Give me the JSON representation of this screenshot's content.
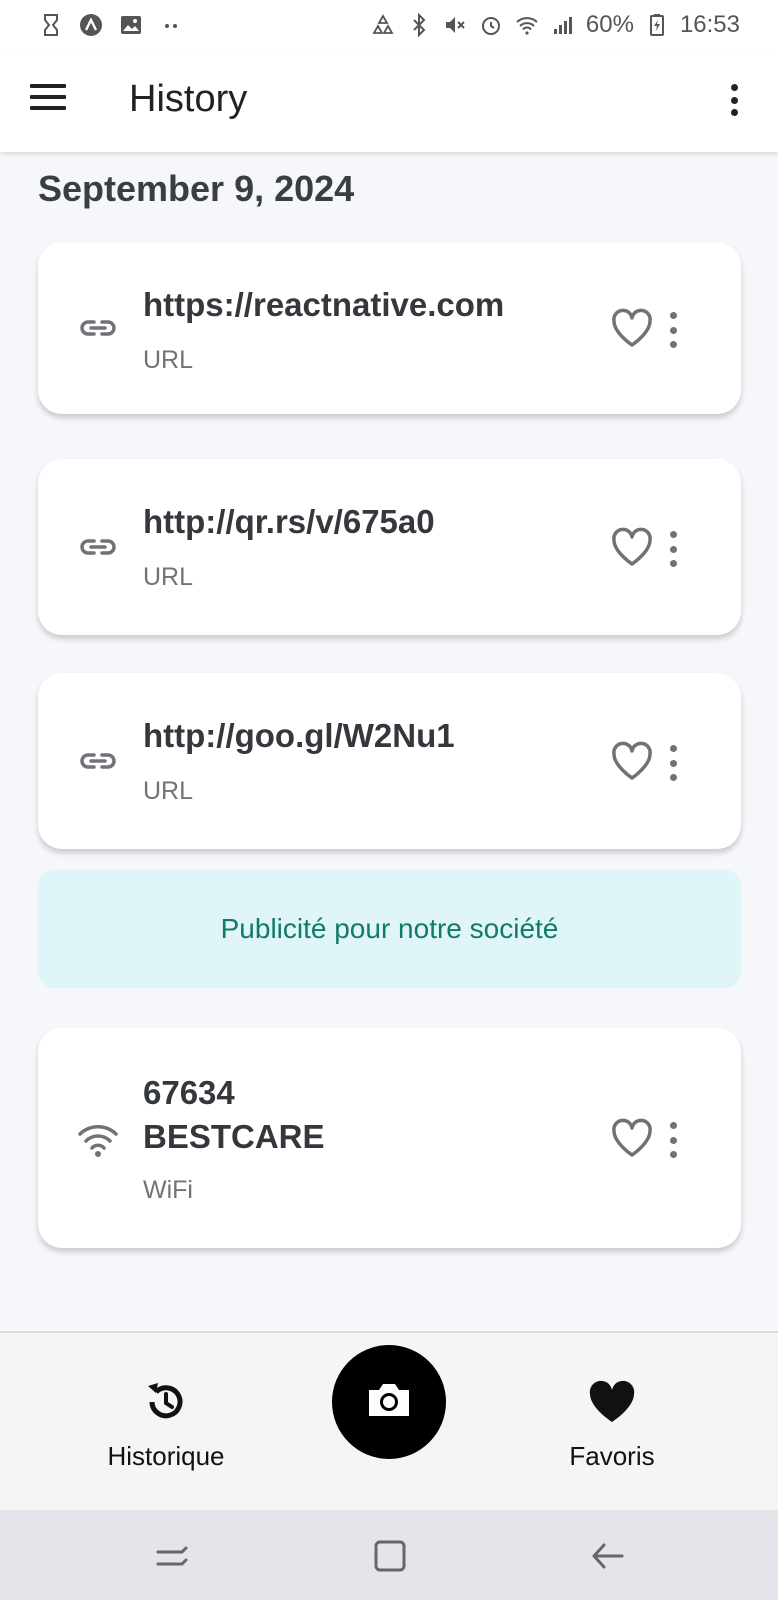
{
  "status_bar": {
    "battery": "60%",
    "time": "16:53"
  },
  "app_bar": {
    "title": "History"
  },
  "history": {
    "date_header": "September 9, 2024",
    "items": [
      {
        "title": "https://reactnative.com",
        "type": "URL",
        "icon": "link-icon"
      },
      {
        "title": "http://qr.rs/v/675a0",
        "type": "URL",
        "icon": "link-icon"
      },
      {
        "title": "http://goo.gl/W2Nu1",
        "type": "URL",
        "icon": "link-icon"
      },
      {
        "title_line1": "67634",
        "title_line2": "BESTCARE",
        "type": "WiFi",
        "icon": "wifi-icon"
      }
    ]
  },
  "ad": {
    "text": "Publicité pour notre société"
  },
  "tabs": {
    "history_label": "Historique",
    "favorites_label": "Favoris"
  },
  "colors": {
    "accent_ad_bg": "#dff5f7",
    "accent_ad_text": "#127a6a",
    "camera_button": "#000000"
  }
}
